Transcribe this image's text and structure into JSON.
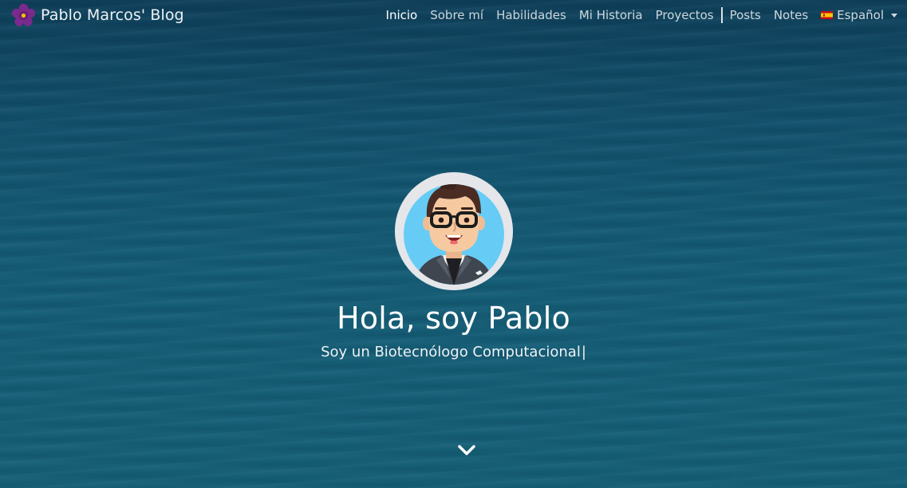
{
  "brand": {
    "title": "Pablo Marcos' Blog",
    "logo_icon": "purple-flower-icon"
  },
  "nav": {
    "items": [
      {
        "label": "Inicio",
        "active": true
      },
      {
        "label": "Sobre mí",
        "active": false
      },
      {
        "label": "Habilidades",
        "active": false
      },
      {
        "label": "Mi Historia",
        "active": false
      },
      {
        "label": "Proyectos",
        "active": false
      },
      {
        "label": "Posts",
        "active": false
      },
      {
        "label": "Notes",
        "active": false
      }
    ],
    "language": {
      "label": "Español",
      "flag": "spain-flag-icon"
    }
  },
  "hero": {
    "title": "Hola, soy Pablo",
    "subtitle": "Soy un Biotecnólogo Computacional",
    "cursor": "|",
    "avatar_icon": "avatar-cartoon-icon",
    "scroll_icon": "chevron-down-icon"
  },
  "colors": {
    "background": "#0f5a73",
    "logo_petal": "#7a2a8c",
    "logo_center": "#f2c200",
    "avatar_ring": "#e4e6ea",
    "avatar_bg": "#66ccf5"
  }
}
